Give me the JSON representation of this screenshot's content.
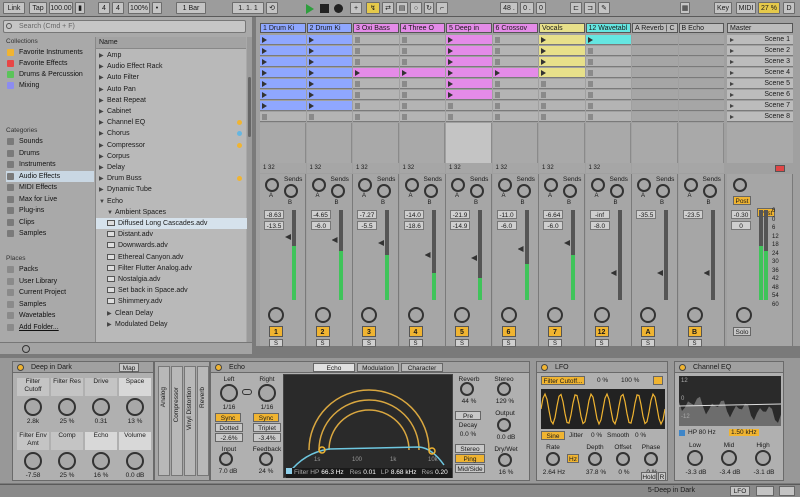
{
  "colors": {
    "accent": "#f0b431",
    "blue": "#8fa7ff",
    "pink": "#e48be8",
    "cyan": "#65e6e1",
    "yellow": "#e7d07a",
    "green_meter": "#3fc45a"
  },
  "transport": {
    "link": "Link",
    "tap": "Tap",
    "tempo": "100.00",
    "sig_num": "4",
    "sig_den": "4",
    "zoom": "100%",
    "quant": "1 Bar",
    "pos1": "1.",
    "pos2": "1.",
    "pos3": "1",
    "pos4": "48 .",
    "pos5": "0 .",
    "pos6": "0",
    "key": "Key",
    "midi": "MIDI",
    "cpu": "27 %",
    "d": "D"
  },
  "browser": {
    "search_placeholder": "Search (Cmd + F)",
    "collections_title": "Collections",
    "collections": [
      {
        "label": "Favorite Instruments",
        "color": "#f0b431"
      },
      {
        "label": "Favorite Effects",
        "color": "#e84646"
      },
      {
        "label": "Drums & Percussion",
        "color": "#5bc45a"
      },
      {
        "label": "Mixing",
        "color": "#8c8cf0"
      }
    ],
    "categories_title": "Categories",
    "categories": [
      "Sounds",
      "Drums",
      "Instruments",
      "Audio Effects",
      "MIDI Effects",
      "Max for Live",
      "Plug-ins",
      "Clips",
      "Samples"
    ],
    "places_title": "Places",
    "places": [
      "Packs",
      "User Library",
      "Current Project",
      "Samples",
      "Wavetables",
      "Add Folder..."
    ],
    "name_header": "Name",
    "items": [
      {
        "label": "Amp",
        "kind": "folder",
        "dot": ""
      },
      {
        "label": "Audio Effect Rack",
        "kind": "folder",
        "dot": ""
      },
      {
        "label": "Auto Filter",
        "kind": "folder",
        "dot": ""
      },
      {
        "label": "Auto Pan",
        "kind": "folder",
        "dot": ""
      },
      {
        "label": "Beat Repeat",
        "kind": "folder",
        "dot": ""
      },
      {
        "label": "Cabinet",
        "kind": "folder",
        "dot": ""
      },
      {
        "label": "Channel EQ",
        "kind": "folder",
        "dot": "#f0b431"
      },
      {
        "label": "Chorus",
        "kind": "folder",
        "dot": "#65b6e1"
      },
      {
        "label": "Compressor",
        "kind": "folder",
        "dot": "#f0b431"
      },
      {
        "label": "Corpus",
        "kind": "folder",
        "dot": ""
      },
      {
        "label": "Delay",
        "kind": "folder",
        "dot": ""
      },
      {
        "label": "Drum Buss",
        "kind": "folder",
        "dot": "#f0b431"
      },
      {
        "label": "Dynamic Tube",
        "kind": "folder",
        "dot": ""
      },
      {
        "label": "Echo",
        "kind": "open",
        "dot": ""
      },
      {
        "label": "Ambient Spaces",
        "kind": "subopen",
        "dot": ""
      },
      {
        "label": "Diffused Long Cascades.adv",
        "kind": "file",
        "dot": ""
      },
      {
        "label": "Distant.adv",
        "kind": "file",
        "dot": ""
      },
      {
        "label": "Downwards.adv",
        "kind": "file",
        "dot": ""
      },
      {
        "label": "Ethereal Canyon.adv",
        "kind": "file",
        "dot": ""
      },
      {
        "label": "Filter Flutter Analog.adv",
        "kind": "file",
        "dot": ""
      },
      {
        "label": "Nostalgia.adv",
        "kind": "file",
        "dot": ""
      },
      {
        "label": "Set back in Space.adv",
        "kind": "file",
        "dot": ""
      },
      {
        "label": "Shimmery.adv",
        "kind": "file",
        "dot": ""
      },
      {
        "label": "Clean Delay",
        "kind": "subfolder",
        "dot": ""
      },
      {
        "label": "Modulated Delay",
        "kind": "subfolder",
        "dot": ""
      }
    ]
  },
  "tracks": [
    {
      "name": "1 Drum Ki",
      "color": "#8fa7ff",
      "vol": "-8.63",
      "pan": "-13.5",
      "num": "1",
      "meter": 0.6,
      "clips": [
        1,
        1,
        1,
        1,
        1,
        1,
        1
      ]
    },
    {
      "name": "2 Drum Ki",
      "color": "#8fa7ff",
      "vol": "-4.65",
      "pan": "-6.0",
      "num": "2",
      "meter": 0.55,
      "clips": [
        1,
        1,
        1,
        1,
        1,
        1,
        1
      ]
    },
    {
      "name": "3 Oxi Bass",
      "color": "#e48be8",
      "vol": "-7.27",
      "pan": "-5.5",
      "num": "3",
      "meter": 0.5,
      "clips": [
        0,
        0,
        0,
        1,
        0,
        0,
        0
      ]
    },
    {
      "name": "4 Three O",
      "color": "#e48be8",
      "vol": "-14.0",
      "pan": "-18.6",
      "num": "4",
      "meter": 0.3,
      "clips": [
        0,
        0,
        0,
        1,
        0,
        0,
        0
      ]
    },
    {
      "name": "5 Deep in",
      "color": "#e48be8",
      "vol": "-21.9",
      "pan": "-14.9",
      "num": "5",
      "meter": 0.25,
      "clips": [
        1,
        1,
        1,
        1,
        1,
        1,
        0
      ]
    },
    {
      "name": "6 Crossov",
      "color": "#e48be8",
      "vol": "-11.0",
      "pan": "-6.0",
      "num": "6",
      "meter": 0.4,
      "clips": [
        0,
        0,
        0,
        1,
        0,
        0,
        0
      ]
    },
    {
      "name": "Vocals",
      "color": "#e7e08a",
      "vol": "-6.64",
      "pan": "-6.0",
      "num": "7",
      "meter": 0.5,
      "clips": [
        1,
        1,
        1,
        1,
        0,
        0,
        0
      ]
    },
    {
      "name": "12 Wavetabl",
      "color": "#65e6e1",
      "vol": "-inf",
      "pan": "-8.0",
      "num": "12",
      "meter": 0.0,
      "clips": [
        1,
        0,
        0,
        0,
        0,
        0,
        0
      ]
    },
    {
      "name": "A Reverb | C",
      "color": "#bcbcbc",
      "vol": "-35.5",
      "pan": "",
      "num": "A",
      "meter": 0.0,
      "clips": []
    },
    {
      "name": "B Echo",
      "color": "#bcbcbc",
      "vol": "-23.5",
      "pan": "",
      "num": "B",
      "meter": 0.0,
      "clips": []
    }
  ],
  "master": {
    "name": "Master",
    "vol": "-0.30",
    "pan": "0",
    "scenes": [
      "Scene 1",
      "Scene 2",
      "Scene 3",
      "Scene 4",
      "Scene 5",
      "Scene 6",
      "Scene 7",
      "Scene 8"
    ],
    "post": "Post",
    "solo": "Solo",
    "scale": [
      "6",
      "0",
      "6",
      "12",
      "18",
      "24",
      "30",
      "36",
      "42",
      "48",
      "54",
      "60"
    ]
  },
  "sends_label": "Sends",
  "sends_letters": [
    "A",
    "B"
  ],
  "devices": {
    "rack": {
      "title": "Deep in Dark",
      "map": "Map",
      "macros": [
        {
          "label": "Filter Cutoff",
          "value": "2.8k"
        },
        {
          "label": "Filter Res",
          "value": "25 %"
        },
        {
          "label": "Drive",
          "value": "0.31"
        },
        {
          "label": "Space",
          "value": "13 %"
        },
        {
          "label": "Filter Env Amt",
          "value": "-7.58"
        },
        {
          "label": "Comp",
          "value": "25 %"
        },
        {
          "label": "Echo",
          "value": "16 %"
        },
        {
          "label": "Volume",
          "value": "0.0 dB"
        }
      ],
      "chain": [
        "Analog",
        "Compressor",
        "Vinyl Distortion",
        "Reverb"
      ]
    },
    "echo": {
      "title": "Echo",
      "tabs": [
        "Echo",
        "Modulation",
        "Character"
      ],
      "left": "Left",
      "right": "Right",
      "left_val": "1/16",
      "right_val": "1/16",
      "sync": "Sync",
      "dotted": "Dotted",
      "triplet": "Triplet",
      "left_pct": "-2.6%",
      "right_pct": "-3.4%",
      "input": "Input",
      "input_val": "7.0 dB",
      "feedback": "Feedback",
      "feedback_val": "24 %",
      "filter_hp": "Filter HP",
      "hp_val": "66.3 Hz",
      "res_label": "Res",
      "res_val": "0.01",
      "lp_label": "LP",
      "lp_val": "8.68 kHz",
      "res2_val": "0.20",
      "grid": [
        "1s",
        "100",
        "1k",
        "10k"
      ],
      "reverb": "Reverb",
      "reverb_val": "44 %",
      "stereo": "Stereo",
      "stereo_val": "129 %",
      "pre": "Pre",
      "output": "Output",
      "output_val": "0.0 dB",
      "decay": "Decay",
      "decay_val": "0.0 %",
      "stereo_btn": "Stereo",
      "ping_pong": "Ping Pong",
      "mid_side": "Mid/Side",
      "drywet": "Dry/Wet",
      "drywet_val": "16 %"
    },
    "lfo": {
      "title": "LFO",
      "param": "Filter Cutoff...",
      "a": "0 %",
      "b": "100 %",
      "wave": "Sine",
      "jitter": "Jitter",
      "jitter_val": "0 %",
      "smooth": "Smooth",
      "smooth_val": "0 %",
      "rate": "Rate",
      "rate_val": "2.64 Hz",
      "hz": "Hz",
      "depth": "Depth",
      "depth_val": "37.8 %",
      "offset": "Offset",
      "offset_val": "0 %",
      "phase": "Phase",
      "phase_val": "0 %",
      "hold": "Hold",
      "r": "R"
    },
    "eq": {
      "title": "Channel EQ",
      "hp": "HP 80 Hz",
      "freq": "1.50 kHz",
      "low": "Low",
      "low_val": "-3.3 dB",
      "mid": "Mid",
      "mid_val": "-3.4 dB",
      "high": "High",
      "high_val": "-3.1 dB",
      "scale": [
        "12",
        "0",
        "-12"
      ]
    }
  },
  "status": {
    "track": "5-Deep in Dark",
    "lfo": "LFO"
  }
}
